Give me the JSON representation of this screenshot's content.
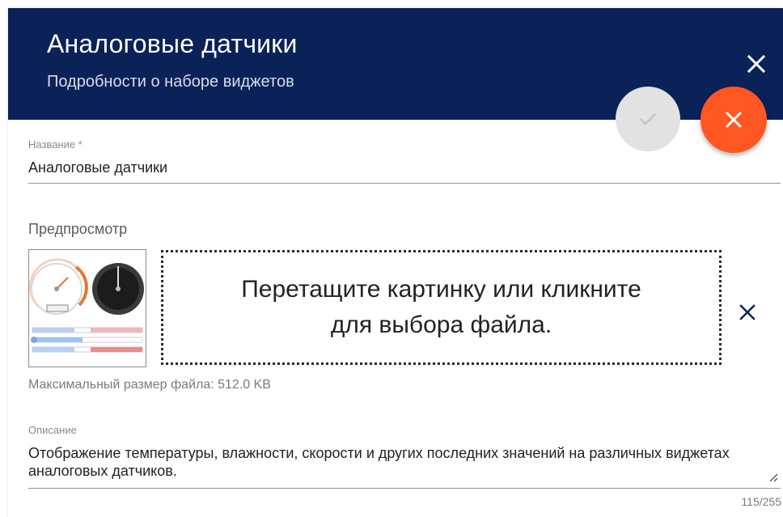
{
  "header": {
    "title": "Аналоговые датчики",
    "subtitle": "Подробности о наборе виджетов",
    "close_icon": "close-icon",
    "background": "#0a2258"
  },
  "actions": {
    "save_icon": "check-icon",
    "cancel_icon": "close-icon",
    "cancel_color": "#ff5722"
  },
  "form": {
    "name": {
      "label": "Название *",
      "value": "Аналоговые датчики"
    },
    "preview": {
      "section_title": "Предпросмотр",
      "thumbnail_icon": "gauges-preview-image",
      "dropzone_line1": "Перетащите картинку или кликните",
      "dropzone_line2": "для выбора файла.",
      "remove_icon": "close-icon",
      "max_size_hint": "Максимальный размер файла: 512.0 KB"
    },
    "description": {
      "label": "Описание",
      "value": "Отображение температуры, влажности, скорости и других последних значений на различных виджетах аналоговых датчиков.",
      "counter": "115/255"
    }
  }
}
